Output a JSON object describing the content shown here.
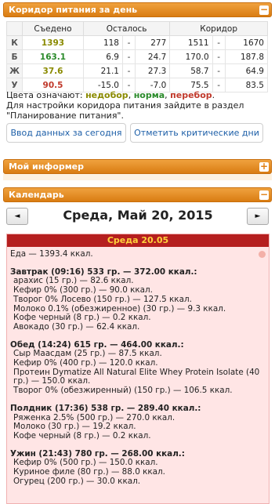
{
  "corridor_panel": {
    "title": "Коридор питания за день",
    "toggle": "−",
    "headers": [
      "",
      "Съедено",
      "Осталось",
      "Коридор"
    ],
    "rows": [
      {
        "label": "К",
        "eaten": "1393",
        "eaten_color": "#8a8a00",
        "left_from": "118",
        "left_to": "277",
        "corr_from": "1511",
        "corr_to": "1670"
      },
      {
        "label": "Б",
        "eaten": "163.1",
        "eaten_color": "#2a8a2a",
        "left_from": "6.9",
        "left_to": "24.7",
        "corr_from": "170.0",
        "corr_to": "187.8"
      },
      {
        "label": "Ж",
        "eaten": "37.6",
        "eaten_color": "#8a8a00",
        "left_from": "21.1",
        "left_to": "27.3",
        "corr_from": "58.7",
        "corr_to": "64.9"
      },
      {
        "label": "У",
        "eaten": "90.5",
        "eaten_color": "#c0392b",
        "left_from": "-15.0",
        "left_to": "-7.0",
        "corr_from": "75.5",
        "corr_to": "83.5"
      }
    ],
    "dash": "-",
    "legend_prefix": "Цвета означают: ",
    "legend_under": "недобор",
    "legend_norm": "норма",
    "legend_over": "перебор",
    "legend_under_color": "#8a8a00",
    "legend_norm_color": "#2a8a2a",
    "legend_over_color": "#c0392b",
    "note": "Для настройки коридора питания зайдите в раздел \"Планирование питания\".",
    "btn_today": "Ввод данных за сегодня",
    "btn_critical": "Отметить критические дни"
  },
  "informer_panel": {
    "title": "Мой информер",
    "toggle": "+"
  },
  "calendar_panel": {
    "title": "Календарь",
    "toggle": "−",
    "prev": "◄",
    "next": "►",
    "date_title": "Среда, Май 20, 2015",
    "day_header": "Среда 20.05",
    "food_total": "Еда — 1393.4 ккал.",
    "meals": [
      {
        "title": "Завтрак (09:16) 533 гр. — 372.00 ккал.:",
        "items": [
          "арахис (15 гр.) — 82.6 ккал.",
          "Кефир 0% (300 гр.) — 90.0 ккал.",
          "Творог 0% Лосево (150 гр.) — 127.5 ккал.",
          "Молоко 0.1% (обезжиренное) (30 гр.) — 9.3 ккал.",
          "Кофе черный (8 гр.) — 0.2 ккал.",
          "Авокадо (30 гр.) — 62.4 ккал."
        ]
      },
      {
        "title": "Обед (14:24) 615 гр. — 464.00 ккал.:",
        "items": [
          "Сыр Маасдам (25 гр.) — 87.5 ккал.",
          "Кефир 0% (400 гр.) — 120.0 ккал.",
          "Протеин Dymatize All Natural Elite Whey Protein Isolate (40 гр.) — 150.0 ккал.",
          "Творог 0% (обезжиренный) (150 гр.) — 106.5 ккал."
        ]
      },
      {
        "title": "Полдник (17:36) 538 гр. — 289.40 ккал.:",
        "items": [
          "Ряженка 2.5% (500 гр.) — 270.0 ккал.",
          "Молоко (30 гр.) — 19.2 ккал.",
          "Кофе черный (8 гр.) — 0.2 ккал."
        ]
      },
      {
        "title": "Ужин (21:43) 780 гр. — 268.00 ккал.:",
        "items": [
          "Кефир 0% (500 гр.) — 150.0 ккал.",
          "Куриное филе (80 гр.) — 88.0 ккал.",
          "Огурец (200 гр.) — 30.0 ккал."
        ]
      }
    ]
  }
}
